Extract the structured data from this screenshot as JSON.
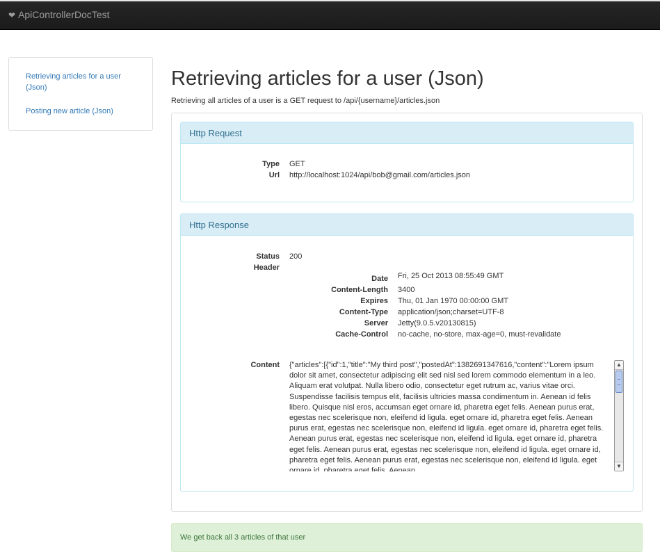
{
  "navbar": {
    "brand": "ApiControllerDocTest",
    "brand_icon": "heart-icon"
  },
  "sidebar": {
    "items": [
      {
        "label": "Retrieving articles for a user (Json)"
      },
      {
        "label": "Posting new article (Json)"
      }
    ]
  },
  "main": {
    "title": "Retrieving articles for a user (Json)",
    "description": "Retrieving all articles of a user is a GET request to /api/{username}/articles.json"
  },
  "request": {
    "heading": "Http Request",
    "type_label": "Type",
    "type": "GET",
    "url_label": "Url",
    "url": "http://localhost:1024/api/bob@gmail.com/articles.json"
  },
  "response": {
    "heading": "Http Response",
    "status_label": "Status",
    "status": "200",
    "header_label": "Header",
    "headers": [
      {
        "name": "Date",
        "value": "Fri, 25 Oct 2013 08:55:49 GMT"
      },
      {
        "name": "Content-Length",
        "value": "3400"
      },
      {
        "name": "Expires",
        "value": "Thu, 01 Jan 1970 00:00:00 GMT"
      },
      {
        "name": "Content-Type",
        "value": "application/json;charset=UTF-8"
      },
      {
        "name": "Server",
        "value": "Jetty(9.0.5.v20130815)"
      },
      {
        "name": "Cache-Control",
        "value": "no-cache, no-store, max-age=0, must-revalidate"
      }
    ],
    "content_label": "Content",
    "content": "{\"articles\":[{\"id\":1,\"title\":\"My third post\",\"postedAt\":1382691347616,\"content\":\"Lorem ipsum dolor sit amet, consectetur adipiscing elit sed nisl sed lorem commodo elementum in a leo. Aliquam erat volutpat. Nulla libero odio, consectetur eget rutrum ac, varius vitae orci. Suspendisse facilisis tempus elit, facilisis ultricies massa condimentum in. Aenean id felis libero. Quisque nisl eros, accumsan eget ornare id, pharetra eget felis. Aenean purus erat, egestas nec scelerisque non, eleifend id ligula. eget ornare id, pharetra eget felis. Aenean purus erat, egestas nec scelerisque non, eleifend id ligula. eget ornare id, pharetra eget felis. Aenean purus erat, egestas nec scelerisque non, eleifend id ligula. eget ornare id, pharetra eget felis. Aenean purus erat, egestas nec scelerisque non, eleifend id ligula. eget ornare id, pharetra eget felis. Aenean purus erat, egestas nec scelerisque non, eleifend id ligula. eget ornare id, pharetra eget felis. Aenean"
  },
  "alert": {
    "message": "We get back all 3 articles of that user"
  }
}
